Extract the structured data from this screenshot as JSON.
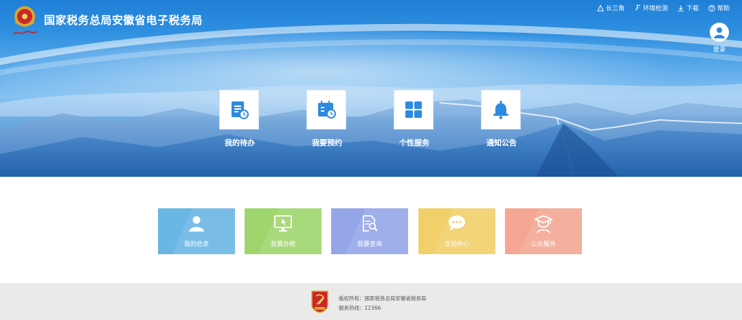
{
  "header": {
    "title": "国家税务总局安徽省电子税务局",
    "nav": [
      {
        "label": "长三角",
        "icon": "triangle-icon"
      },
      {
        "label": "环境检测",
        "icon": "wrench-icon"
      },
      {
        "label": "下载",
        "icon": "download-icon"
      },
      {
        "label": "帮助",
        "icon": "help-icon"
      }
    ],
    "login_label": "登录",
    "logo_icon": "tax-emblem-icon"
  },
  "quick_links": [
    {
      "label": "我的待办",
      "icon": "todo-list-icon"
    },
    {
      "label": "我要预约",
      "icon": "calendar-clock-icon"
    },
    {
      "label": "个性服务",
      "icon": "grid-icon"
    },
    {
      "label": "通知公告",
      "icon": "bell-icon"
    }
  ],
  "tiles": [
    {
      "label": "我的信息",
      "icon": "user-icon",
      "color": "#6ab6e4"
    },
    {
      "label": "我要办税",
      "icon": "monitor-icon",
      "color": "#9fd56d"
    },
    {
      "label": "我要查询",
      "icon": "document-search-icon",
      "color": "#94a6e8"
    },
    {
      "label": "互动中心",
      "icon": "chat-icon",
      "color": "#f1d06a"
    },
    {
      "label": "公众服务",
      "icon": "graduate-icon",
      "color": "#f4a693"
    }
  ],
  "footer": {
    "copyright": "版权所有：国家税务总局安徽省税务局",
    "hotline": "服务热线：12366",
    "badge_icon": "party-badge-icon"
  },
  "colors": {
    "banner_top": "#1f7fd6",
    "accent": "#2c8be0",
    "footer_bg": "#eaeaea"
  }
}
